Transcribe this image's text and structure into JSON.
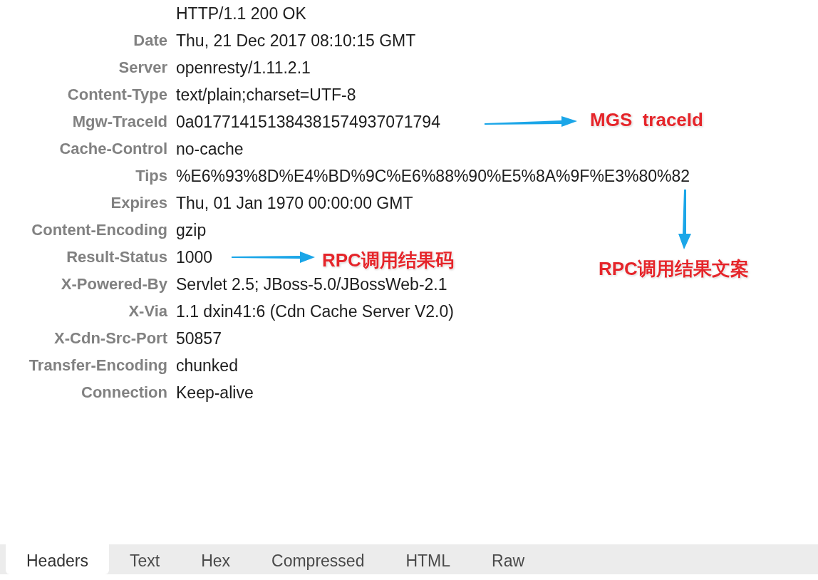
{
  "status_line": "HTTP/1.1 200 OK",
  "headers": [
    {
      "name": "Date",
      "value": "Thu, 21 Dec 2017 08:10:15 GMT"
    },
    {
      "name": "Server",
      "value": "openresty/1.11.2.1"
    },
    {
      "name": "Content-Type",
      "value": "text/plain;charset=UTF-8"
    },
    {
      "name": "Mgw-TraceId",
      "value": "0a017714151384381574937071794"
    },
    {
      "name": "Cache-Control",
      "value": "no-cache"
    },
    {
      "name": "Tips",
      "value": "%E6%93%8D%E4%BD%9C%E6%88%90%E5%8A%9F%E3%80%82"
    },
    {
      "name": "Expires",
      "value": "Thu, 01 Jan 1970 00:00:00 GMT"
    },
    {
      "name": "Content-Encoding",
      "value": "gzip"
    },
    {
      "name": "Result-Status",
      "value": "1000"
    },
    {
      "name": "X-Powered-By",
      "value": "Servlet 2.5; JBoss-5.0/JBossWeb-2.1"
    },
    {
      "name": "X-Via",
      "value": "1.1 dxin41:6 (Cdn Cache Server V2.0)"
    },
    {
      "name": "X-Cdn-Src-Port",
      "value": "50857"
    },
    {
      "name": "Transfer-Encoding",
      "value": "chunked"
    },
    {
      "name": "Connection",
      "value": "Keep-alive"
    }
  ],
  "annotations": [
    {
      "label": "MGS  traceId"
    },
    {
      "label": "RPC调用结果码"
    },
    {
      "label": "RPC调用结果文案"
    }
  ],
  "tabs": [
    {
      "label": "Headers",
      "selected": true
    },
    {
      "label": "Text",
      "selected": false
    },
    {
      "label": "Hex",
      "selected": false
    },
    {
      "label": "Compressed",
      "selected": false
    },
    {
      "label": "HTML",
      "selected": false
    },
    {
      "label": "Raw",
      "selected": false
    }
  ]
}
